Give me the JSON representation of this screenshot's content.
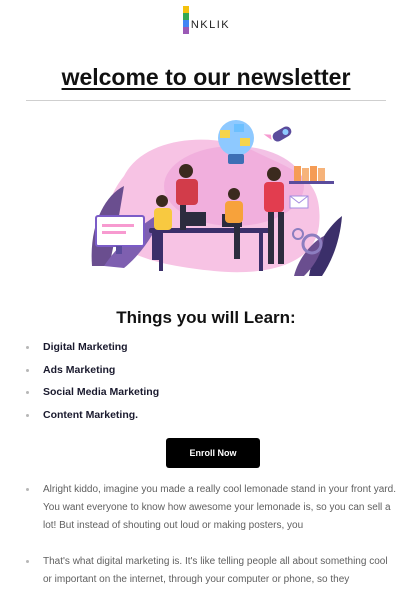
{
  "logo": {
    "text": "NKLIK",
    "icon": "inklik-logo-icon"
  },
  "headline": "welcome to our newsletter",
  "illustration": {
    "icon": "team-working-illustration"
  },
  "section_title": "Things you will Learn:",
  "topics": [
    "Digital Marketing",
    "Ads Marketing",
    "Social Media Marketing",
    "Content Marketing."
  ],
  "enroll_button": "Enroll Now",
  "paragraphs": [
    "Alright kiddo, imagine you made a really cool lemonade stand in your front yard. You want everyone to know how awesome your lemonade is, so you can sell a lot! But instead of shouting out loud or making posters, you",
    "That's what digital marketing is. It's like telling people all about something cool or important on the internet, through your computer or phone, so they"
  ],
  "colors": {
    "accent": "#000000",
    "illustration_pink": "#f3b6e1",
    "illustration_purple": "#7b5cc7"
  }
}
